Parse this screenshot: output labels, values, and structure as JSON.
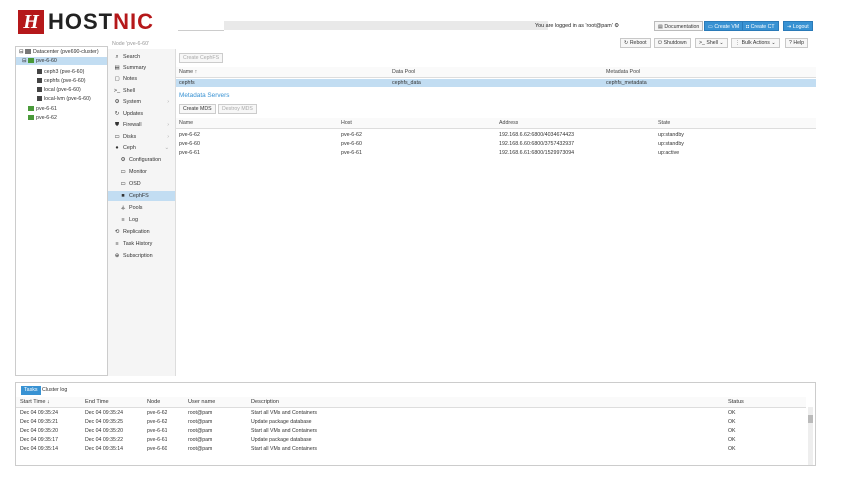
{
  "header": {
    "logo_letter": "H",
    "logo_word_a": "HOST",
    "logo_word_b": "NIC",
    "logged_in_text": "You are logged in as 'root@pam'",
    "buttons": {
      "documentation": "Documentation",
      "create_vm": "Create VM",
      "create_ct": "Create CT",
      "logout": "Logout"
    }
  },
  "toolbar": {
    "crumb": "Node 'pve-6-60'",
    "reboot": "Reboot",
    "shutdown": "Shutdown",
    "shell": "Shell",
    "bulk_actions": "Bulk Actions",
    "help": "Help"
  },
  "tree": {
    "datacenter": "Datacenter (pve690-cluster)",
    "node_sel": "pve-6-60",
    "storages": [
      "ceph3 (pve-6-60)",
      "cephfs (pve-6-60)",
      "local (pve-6-60)",
      "local-lvm (pve-6-60)"
    ],
    "nodes": [
      "pve-6-61",
      "pve-6-62"
    ]
  },
  "nav": {
    "search": "Search",
    "summary": "Summary",
    "notes": "Notes",
    "shell": "Shell",
    "system": "System",
    "updates": "Updates",
    "firewall": "Firewall",
    "disks": "Disks",
    "ceph": "Ceph",
    "configuration": "Configuration",
    "monitor": "Monitor",
    "osd": "OSD",
    "cephfs": "CephFS",
    "pools": "Pools",
    "log": "Log",
    "replication": "Replication",
    "task_history": "Task History",
    "subscription": "Subscription"
  },
  "cephfs": {
    "create_button": "Create CephFS",
    "columns": [
      "Name ↑",
      "Data Pool",
      "Metadata Pool"
    ],
    "row": {
      "name": "cephfs",
      "data_pool": "cephfs_data",
      "metadata_pool": "cephfs_metadata"
    },
    "metadata_title": "Metadata Servers",
    "create_mds": "Create MDS",
    "destroy_mds": "Destroy MDS",
    "mds_columns": [
      "Name",
      "Host",
      "Address",
      "State"
    ],
    "mds_rows": [
      {
        "name": "pve-6-62",
        "host": "pve-6-62",
        "address": "192.168.6.62:6800/4034674423",
        "state": "up:standby"
      },
      {
        "name": "pve-6-60",
        "host": "pve-6-60",
        "address": "192.168.6.60:6800/3757432937",
        "state": "up:standby"
      },
      {
        "name": "pve-6-61",
        "host": "pve-6-61",
        "address": "192.168.6.61:6800/1529973094",
        "state": "up:active"
      }
    ]
  },
  "log": {
    "tabs": [
      "Tasks",
      "Cluster log"
    ],
    "columns": [
      "Start Time ↓",
      "End Time",
      "Node",
      "User name",
      "Description",
      "Status"
    ],
    "rows": [
      {
        "start": "Dec 04 09:35:24",
        "end": "Dec 04 09:35:24",
        "node": "pve-6-62",
        "user": "root@pam",
        "desc": "Start all VMs and Containers",
        "status": "OK"
      },
      {
        "start": "Dec 04 09:35:21",
        "end": "Dec 04 09:35:25",
        "node": "pve-6-62",
        "user": "root@pam",
        "desc": "Update package database",
        "status": "OK"
      },
      {
        "start": "Dec 04 09:35:20",
        "end": "Dec 04 09:35:20",
        "node": "pve-6-61",
        "user": "root@pam",
        "desc": "Start all VMs and Containers",
        "status": "OK"
      },
      {
        "start": "Dec 04 09:35:17",
        "end": "Dec 04 09:35:22",
        "node": "pve-6-61",
        "user": "root@pam",
        "desc": "Update package database",
        "status": "OK"
      },
      {
        "start": "Dec 04 09:35:14",
        "end": "Dec 04 09:35:14",
        "node": "pve-6-60",
        "user": "root@pam",
        "desc": "Start all VMs and Containers",
        "status": "OK"
      }
    ]
  },
  "colors": {
    "accent": "#3892d3",
    "brand": "#b5181a",
    "selection": "#c2ddf2"
  }
}
